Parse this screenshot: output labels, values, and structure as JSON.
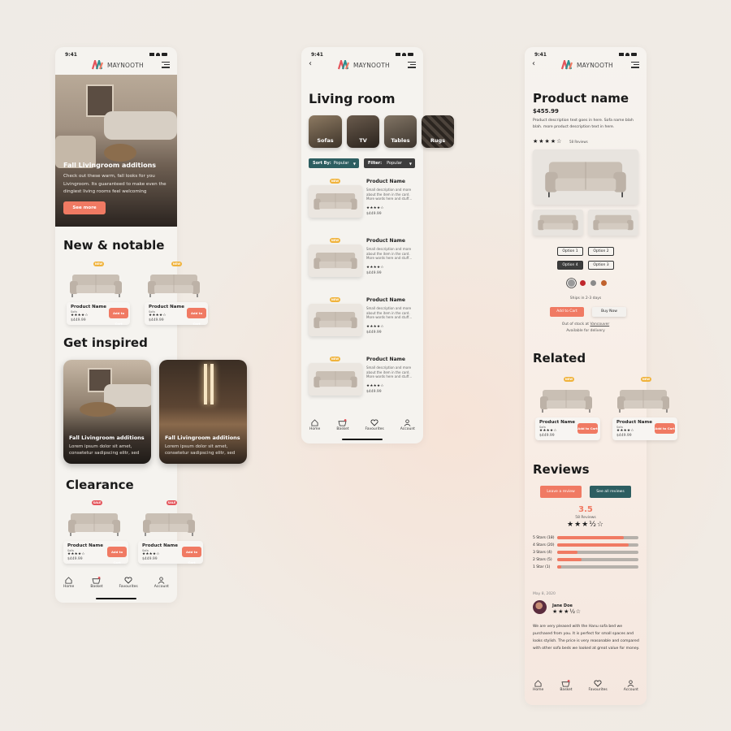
{
  "status_time": "9:41",
  "brand": "MAYNOOTH",
  "colors": {
    "accent": "#f07a63",
    "teal": "#2d5e61",
    "new_tag": "#f0b33c",
    "sale_tag": "#e4545b"
  },
  "home": {
    "hero": {
      "title": "Fall Livingroom additions",
      "text": "Check out these warm, fall looks for you Livingroom. Its guaranteed to make even the dingiest living rooms feel welcoming",
      "button": "See more"
    },
    "new_notable_title": "New & notable",
    "new_products": [
      {
        "tag": "new",
        "name": "Product Name",
        "sub": "Sofa",
        "stars": "★★★★☆",
        "price": "$449.99",
        "button": "Add to Cart"
      },
      {
        "tag": "new",
        "name": "Product Name",
        "sub": "Sofa",
        "stars": "★★★★☆",
        "price": "$449.99",
        "button": "Add to Cart"
      }
    ],
    "inspired_title": "Get inspired",
    "inspired": [
      {
        "title": "Fall Livingroom additions",
        "text": "Lorem ipsum dolor sit amet, consetetur sadipscing elitr, sed"
      },
      {
        "title": "Fall Livingroom additions",
        "text": "Lorem ipsum dolor sit amet, consetetur sadipscing elitr, sed"
      }
    ],
    "clearance_title": "Clearance",
    "clearance_products": [
      {
        "tag": "sale",
        "name": "Product Name",
        "sub": "Sofa",
        "stars": "★★★★☆",
        "price": "$449.99",
        "button": "Add to Cart"
      },
      {
        "tag": "sale",
        "name": "Product Name",
        "sub": "Sofa",
        "stars": "★★★★☆",
        "price": "$449.99",
        "button": "Add to Cart"
      }
    ]
  },
  "tabbar": [
    "Home",
    "Basket",
    "Favourites",
    "Account"
  ],
  "category": {
    "title": "Living room",
    "chips": [
      "Sofas",
      "TV",
      "Tables",
      "Rugs"
    ],
    "sort_label": "Sort By:",
    "sort_value": "Popular",
    "filter_label": "Filter:",
    "filter_value": "Popular",
    "items": [
      {
        "tag": "new",
        "name": "Product Name",
        "desc": "Small description and more about the item in the card. More words here and stuff...",
        "stars": "★★★★☆",
        "price": "$449.99"
      },
      {
        "tag": "new",
        "name": "Product Name",
        "desc": "Small description and more about the item in the card. More words here and stuff...",
        "stars": "★★★★☆",
        "price": "$449.99"
      },
      {
        "tag": "new",
        "name": "Product Name",
        "desc": "Small description and more about the item in the card. More words here and stuff...",
        "stars": "★★★★☆",
        "price": "$449.99"
      },
      {
        "tag": "new",
        "name": "Product Name",
        "desc": "Small description and more about the item in the card. More words here and stuff...",
        "stars": "★★★★☆",
        "price": "$449.99"
      }
    ]
  },
  "product": {
    "title": "Product name",
    "price": "$455.99",
    "description": "Product description text goes in here. Sofa name blah blah. more product description text in here.",
    "stars": "★★★★☆",
    "review_count": "58 Reviews",
    "options": [
      "Option 1",
      "Option 2",
      "Option 4",
      "Option 3"
    ],
    "swatches": [
      "#9a9a9a",
      "#c0272d",
      "#8a8a8a",
      "#c0622d"
    ],
    "shipping": "Ships in 2-3 days",
    "add_to_cart": "Add to Cart",
    "buy_now": "Buy Now",
    "stock_text": "Out of stock at",
    "stock_location": "Vancouver",
    "available": "Available for delivery",
    "related_title": "Related",
    "related": [
      {
        "tag": "new",
        "name": "Product Name",
        "sub": "Sofa",
        "stars": "★★★★☆",
        "price": "$449.99",
        "button": "Add to Cart"
      },
      {
        "tag": "new",
        "name": "Product Name",
        "sub": "Sofa",
        "stars": "★★★★☆",
        "price": "$449.99",
        "button": "Add to Cart"
      }
    ],
    "reviews_title": "Reviews",
    "leave_review": "Leave a review",
    "see_all": "See all reviews",
    "rating": "3.5",
    "rating_reviews": "58 Reviews",
    "rating_stars": "★★★½☆",
    "breakdown": [
      {
        "label": "5 Stars (18)",
        "fill": 0.82
      },
      {
        "label": "4 Stars (20)",
        "fill": 0.88
      },
      {
        "label": "3 Stars (4)",
        "fill": 0.25
      },
      {
        "label": "2 Stars (5)",
        "fill": 0.3
      },
      {
        "label": "1 Star (1)",
        "fill": 0.05
      }
    ],
    "review": {
      "date": "May 8, 2020",
      "author": "Jane Doe",
      "stars": "★★★½☆",
      "text": "We are very pleased with the Hanu sofa bed we purchased from you. It is perfect for small spaces and looks stylish. The price is very reasonable and compared with other sofa beds we looked at great value for money."
    }
  }
}
